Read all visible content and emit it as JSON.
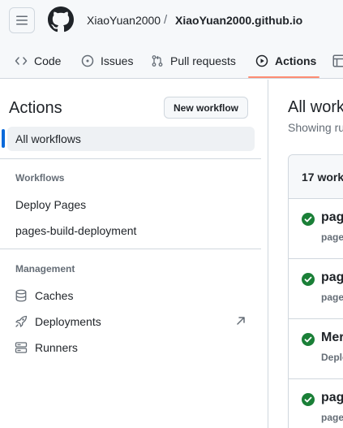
{
  "header": {
    "owner": "XiaoYuan2000",
    "separator": "/",
    "repo": "XiaoYuan2000.github.io"
  },
  "tabs": [
    {
      "label": "Code",
      "icon": "code-icon"
    },
    {
      "label": "Issues",
      "icon": "issue-opened-icon"
    },
    {
      "label": "Pull requests",
      "icon": "git-pull-request-icon"
    },
    {
      "label": "Actions",
      "icon": "play-icon",
      "active": true
    },
    {
      "label": "",
      "icon": "table-icon"
    }
  ],
  "sidebar": {
    "title": "Actions",
    "new_workflow_label": "New workflow",
    "all_workflows_label": "All workflows",
    "workflows_section": "Workflows",
    "workflows": [
      "Deploy Pages",
      "pages-build-deployment"
    ],
    "management_section": "Management",
    "management": [
      {
        "label": "Caches",
        "icon": "database-icon"
      },
      {
        "label": "Deployments",
        "icon": "rocket-icon",
        "external": true
      },
      {
        "label": "Runners",
        "icon": "server-icon"
      }
    ]
  },
  "main": {
    "title": "All work",
    "subtitle": "Showing ru",
    "count_label": "17 workf",
    "runs": [
      {
        "title": "pag",
        "subtitle": "page"
      },
      {
        "title": "pag",
        "subtitle": "page"
      },
      {
        "title": "Mer",
        "subtitle": "Deplo"
      },
      {
        "title": "pag",
        "subtitle": "page"
      }
    ]
  },
  "colors": {
    "accent_blue": "#0969da",
    "active_tab_underline": "#fd8c73",
    "success_green": "#1a7f37",
    "border": "#d0d7de",
    "muted_text": "#656d76"
  }
}
